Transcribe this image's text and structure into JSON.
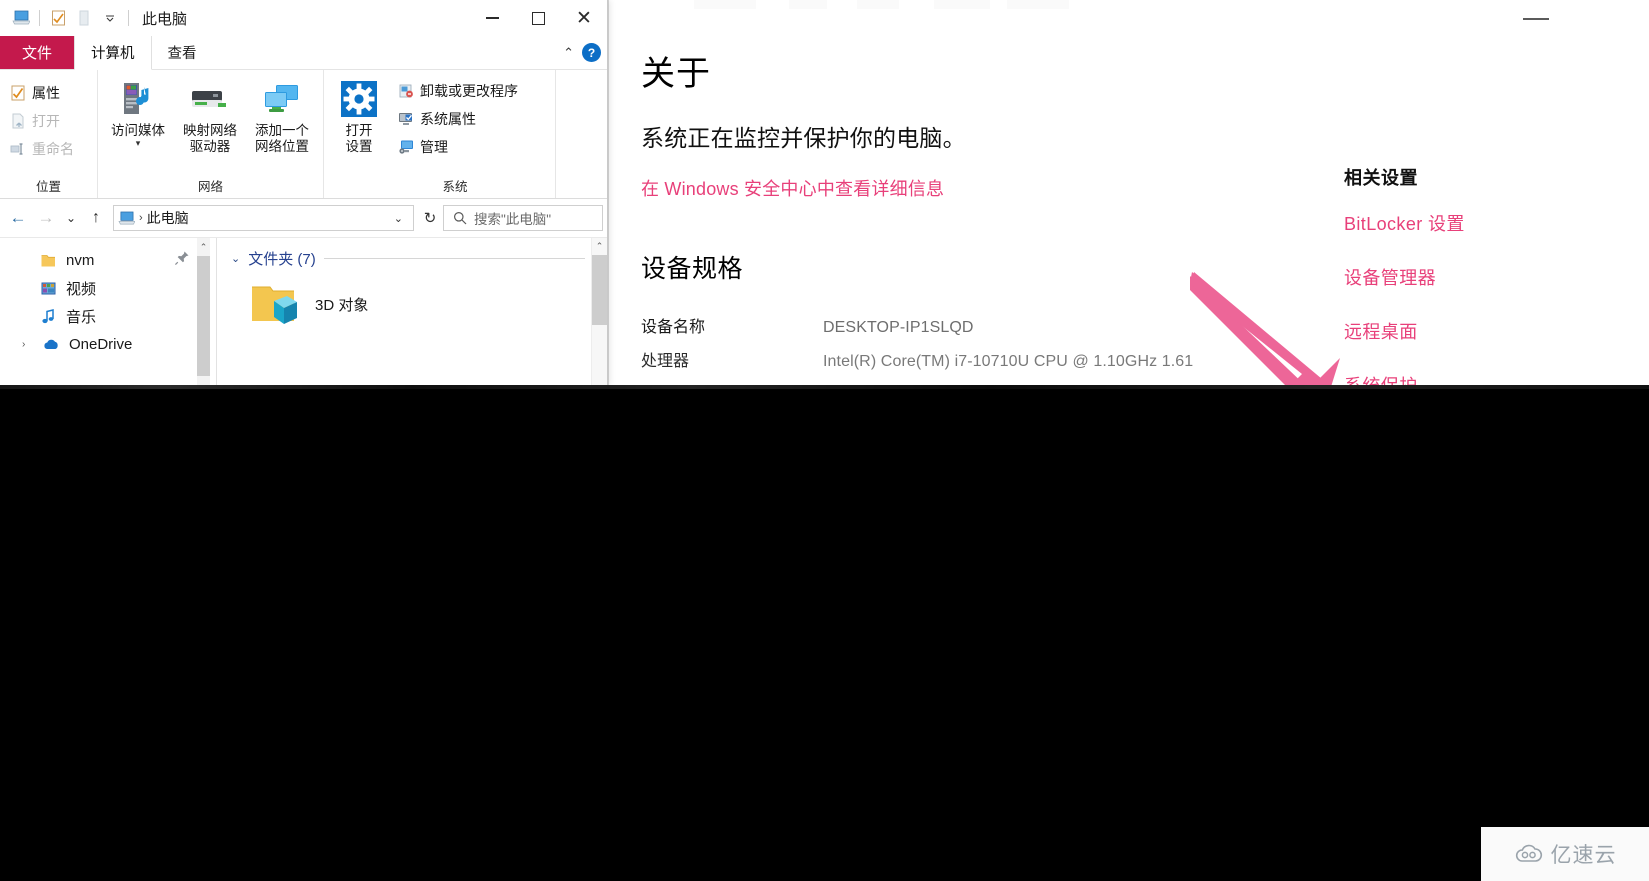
{
  "explorer": {
    "title": "此电脑",
    "quick_access": [
      {
        "name": "this-pc-icon",
        "label": "此电脑"
      },
      {
        "name": "properties-quick-icon",
        "label": "属性"
      },
      {
        "name": "new-folder-quick-icon",
        "label": "新建文件夹"
      },
      {
        "name": "customize-qat-caret",
        "label": "▾"
      }
    ],
    "window_buttons": {
      "minimize": "—",
      "maximize": "▢",
      "close": "✕"
    },
    "tabs": [
      {
        "label": "文件",
        "state": "file-menu"
      },
      {
        "label": "计算机",
        "state": "active"
      },
      {
        "label": "查看",
        "state": "normal"
      }
    ],
    "ribbon_right": {
      "collapse": "⌃",
      "help": "?"
    },
    "ribbon_groups": [
      {
        "title": "位置",
        "small_buttons": [
          {
            "label": "属性",
            "icon": "properties-icon",
            "disabled": false
          },
          {
            "label": "打开",
            "icon": "open-icon",
            "disabled": true
          },
          {
            "label": "重命名",
            "icon": "rename-icon",
            "disabled": true
          }
        ]
      },
      {
        "title": "网络",
        "big_buttons": [
          {
            "label_line1": "访问媒体",
            "label_line2": "",
            "icon": "access-media-icon",
            "has_caret": true
          },
          {
            "label_line1": "映射网络",
            "label_line2": "驱动器",
            "icon": "map-network-drive-icon",
            "has_caret": true
          },
          {
            "label_line1": "添加一个",
            "label_line2": "网络位置",
            "icon": "add-network-location-icon",
            "has_caret": false
          }
        ]
      },
      {
        "title": "系统",
        "big_buttons": [
          {
            "label_line1": "打开",
            "label_line2": "设置",
            "icon": "open-settings-gear-icon",
            "has_caret": false
          }
        ],
        "small_buttons": [
          {
            "label": "卸载或更改程序",
            "icon": "uninstall-program-icon",
            "disabled": false
          },
          {
            "label": "系统属性",
            "icon": "system-properties-icon",
            "disabled": false
          },
          {
            "label": "管理",
            "icon": "manage-icon",
            "disabled": false
          }
        ]
      }
    ],
    "address_bar": {
      "back": "←",
      "forward": "→",
      "recent": "⌄",
      "up": "↑",
      "breadcrumb_icon": "this-pc-icon",
      "breadcrumb": "此电脑",
      "breadcrumb_sep": "›",
      "dropdown_caret": "⌄",
      "refresh": "↻"
    },
    "search": {
      "icon": "search-icon",
      "placeholder": "搜索\"此电脑\""
    },
    "nav_pane": {
      "items": [
        {
          "label": "nvm",
          "icon": "folder-icon",
          "twisty": ""
        },
        {
          "label": "视频",
          "icon": "videos-icon",
          "twisty": ""
        },
        {
          "label": "音乐",
          "icon": "music-icon",
          "twisty": ""
        },
        {
          "label": "OneDrive",
          "icon": "onedrive-icon",
          "twisty": "›"
        }
      ],
      "pin_icon": "pin-icon"
    },
    "content": {
      "group_label": "文件夹 (7)",
      "group_chevron": "⌄",
      "items": [
        {
          "label": "3D 对象",
          "icon": "3d-objects-folder-icon"
        }
      ]
    }
  },
  "settings": {
    "window_buttons": {
      "minimize": "—"
    },
    "page_title": "关于",
    "protection_status": "系统正在监控并保护你的电脑。",
    "security_link": "在 Windows 安全中心中查看详细信息",
    "device_spec_heading": "设备规格",
    "specs": [
      {
        "label": "设备名称",
        "value": "DESKTOP-IP1SLQD"
      },
      {
        "label": "处理器",
        "value": "Intel(R) Core(TM) i7-10710U CPU @ 1.10GHz   1.61"
      }
    ],
    "related": {
      "heading": "相关设置",
      "links": [
        "BitLocker 设置",
        "设备管理器",
        "远程桌面",
        "系统保护"
      ]
    }
  },
  "annotation": {
    "arrow_color": "#ED6698",
    "arrow_name": "pink-pointer-arrow"
  },
  "watermark": {
    "text": "亿速云",
    "icon": "cloud-icon"
  },
  "colors": {
    "file_tab": "#C4194C",
    "accent_pink": "#E8407A",
    "link_blue": "#26418F",
    "gear_blue": "#0C72C6"
  }
}
